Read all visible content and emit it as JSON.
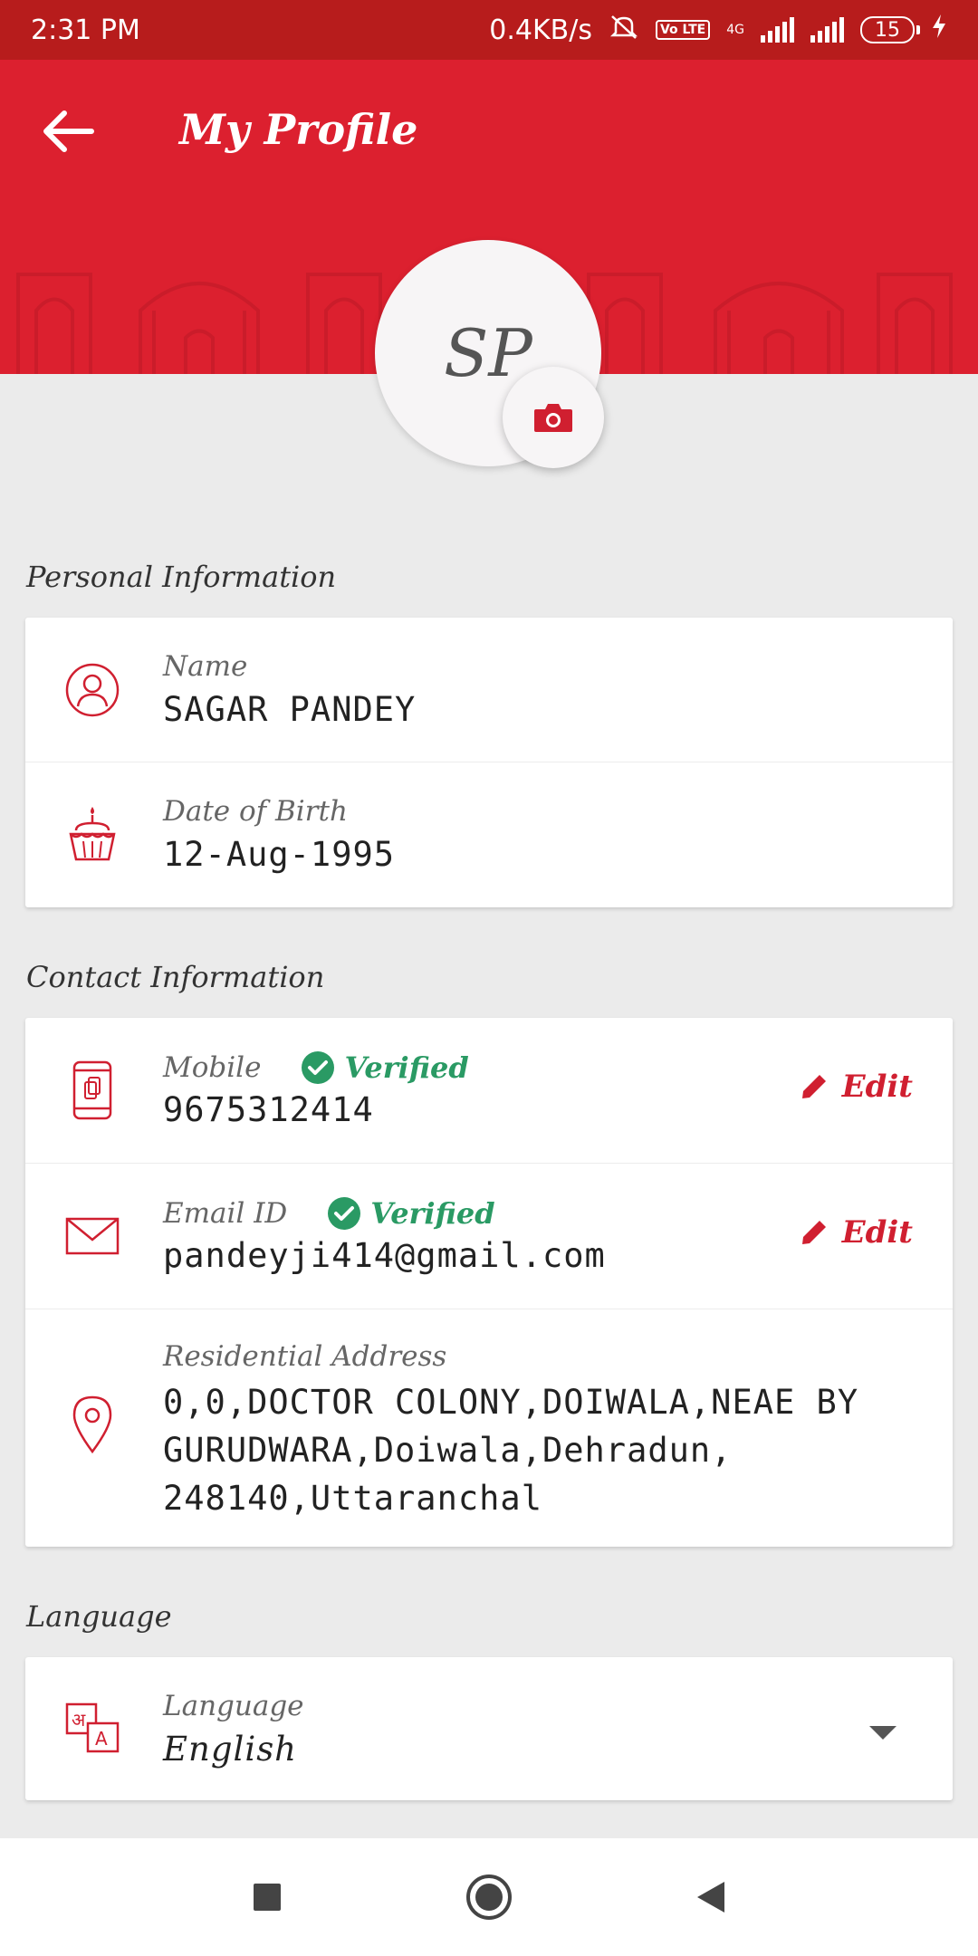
{
  "status_bar": {
    "time": "2:31 PM",
    "speed": "0.4KB/s",
    "volte": "Vo LTE",
    "network": "4G",
    "battery": "15"
  },
  "header": {
    "title": "My Profile",
    "avatar_initials": "SP"
  },
  "sections": {
    "personal": "Personal Information",
    "contact": "Contact Information",
    "language": "Language"
  },
  "personal": {
    "name_label": "Name",
    "name_value": "SAGAR PANDEY",
    "dob_label": "Date of Birth",
    "dob_value": "12-Aug-1995"
  },
  "contact": {
    "mobile_label": "Mobile",
    "mobile_status": "Verified",
    "mobile_value": "9675312414",
    "email_label": "Email ID",
    "email_status": "Verified",
    "email_value": "pandeyji414@gmail.com",
    "edit_label": "Edit",
    "address_label": "Residential Address",
    "address_value": "0,0,DOCTOR COLONY,DOIWALA,NEAE BY GURUDWARA,Doiwala,Dehradun, 248140,Uttaranchal"
  },
  "language": {
    "label": "Language",
    "value": "English"
  },
  "colors": {
    "primary": "#dc202f",
    "status_bar": "#b71c1c",
    "verified": "#2a9a64"
  }
}
